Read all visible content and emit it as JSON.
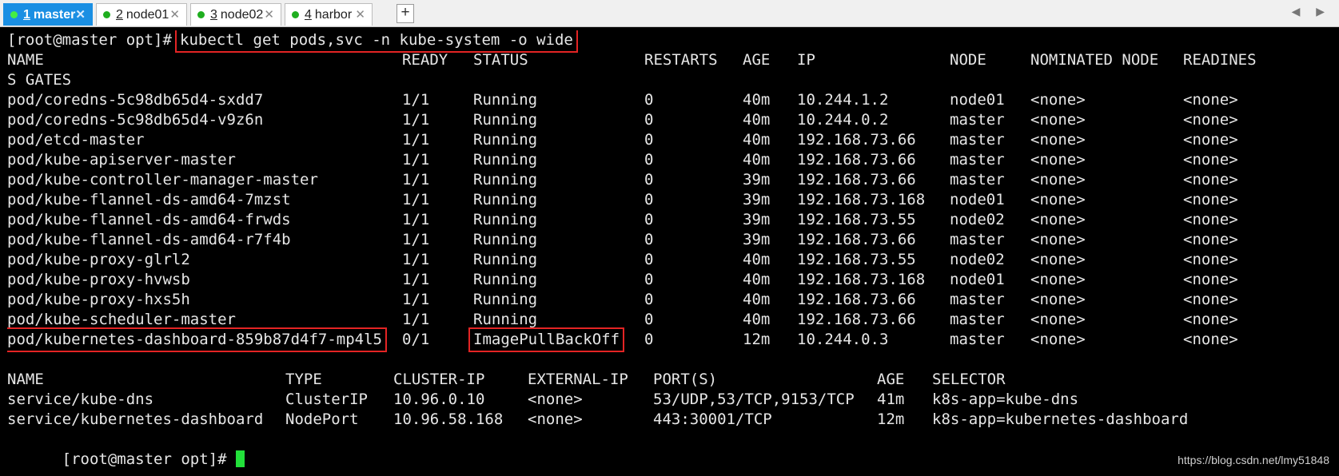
{
  "tabs": [
    {
      "num": "1",
      "label": "master",
      "active": true,
      "dot_color": "#44ee44"
    },
    {
      "num": "2",
      "label": "node01",
      "active": false,
      "dot_color": "#1fae1f"
    },
    {
      "num": "3",
      "label": "node02",
      "active": false,
      "dot_color": "#1fae1f"
    },
    {
      "num": "4",
      "label": "harbor",
      "active": false,
      "dot_color": "#1fae1f"
    }
  ],
  "add_tab": "+",
  "nav_arrows": "◀ ▶",
  "close_glyph": "✕",
  "terminal": {
    "prompt": "[root@master opt]#",
    "command": "kubectl get pods,svc -n kube-system -o wide",
    "pods_header": [
      "NAME",
      "READY",
      "STATUS",
      "RESTARTS",
      "AGE",
      "IP",
      "NODE",
      "NOMINATED NODE",
      "READINES"
    ],
    "pods_header_wrap": "S GATES",
    "pods": [
      [
        "pod/coredns-5c98db65d4-sxdd7",
        "1/1",
        "Running",
        "0",
        "40m",
        "10.244.1.2",
        "node01",
        "<none>",
        "<none>"
      ],
      [
        "pod/coredns-5c98db65d4-v9z6n",
        "1/1",
        "Running",
        "0",
        "40m",
        "10.244.0.2",
        "master",
        "<none>",
        "<none>"
      ],
      [
        "pod/etcd-master",
        "1/1",
        "Running",
        "0",
        "40m",
        "192.168.73.66",
        "master",
        "<none>",
        "<none>"
      ],
      [
        "pod/kube-apiserver-master",
        "1/1",
        "Running",
        "0",
        "40m",
        "192.168.73.66",
        "master",
        "<none>",
        "<none>"
      ],
      [
        "pod/kube-controller-manager-master",
        "1/1",
        "Running",
        "0",
        "39m",
        "192.168.73.66",
        "master",
        "<none>",
        "<none>"
      ],
      [
        "pod/kube-flannel-ds-amd64-7mzst",
        "1/1",
        "Running",
        "0",
        "39m",
        "192.168.73.168",
        "node01",
        "<none>",
        "<none>"
      ],
      [
        "pod/kube-flannel-ds-amd64-frwds",
        "1/1",
        "Running",
        "0",
        "39m",
        "192.168.73.55",
        "node02",
        "<none>",
        "<none>"
      ],
      [
        "pod/kube-flannel-ds-amd64-r7f4b",
        "1/1",
        "Running",
        "0",
        "39m",
        "192.168.73.66",
        "master",
        "<none>",
        "<none>"
      ],
      [
        "pod/kube-proxy-glrl2",
        "1/1",
        "Running",
        "0",
        "40m",
        "192.168.73.55",
        "node02",
        "<none>",
        "<none>"
      ],
      [
        "pod/kube-proxy-hvwsb",
        "1/1",
        "Running",
        "0",
        "40m",
        "192.168.73.168",
        "node01",
        "<none>",
        "<none>"
      ],
      [
        "pod/kube-proxy-hxs5h",
        "1/1",
        "Running",
        "0",
        "40m",
        "192.168.73.66",
        "master",
        "<none>",
        "<none>"
      ],
      [
        "pod/kube-scheduler-master",
        "1/1",
        "Running",
        "0",
        "40m",
        "192.168.73.66",
        "master",
        "<none>",
        "<none>"
      ],
      [
        "pod/kubernetes-dashboard-859b87d4f7-mp4l5",
        "0/1",
        "ImagePullBackOff",
        "0",
        "12m",
        "10.244.0.3",
        "master",
        "<none>",
        "<none>"
      ]
    ],
    "highlight_color": "#e32424",
    "svc_header": [
      "NAME",
      "TYPE",
      "CLUSTER-IP",
      "EXTERNAL-IP",
      "PORT(S)",
      "AGE",
      "SELECTOR"
    ],
    "services": [
      [
        "service/kube-dns",
        "ClusterIP",
        "10.96.0.10",
        "<none>",
        "53/UDP,53/TCP,9153/TCP",
        "41m",
        "k8s-app=kube-dns"
      ],
      [
        "service/kubernetes-dashboard",
        "NodePort",
        "10.96.58.168",
        "<none>",
        "443:30001/TCP",
        "12m",
        "k8s-app=kubernetes-dashboard"
      ]
    ],
    "cursor_color": "#22e03a"
  },
  "watermark": "https://blog.csdn.net/lmy51848"
}
